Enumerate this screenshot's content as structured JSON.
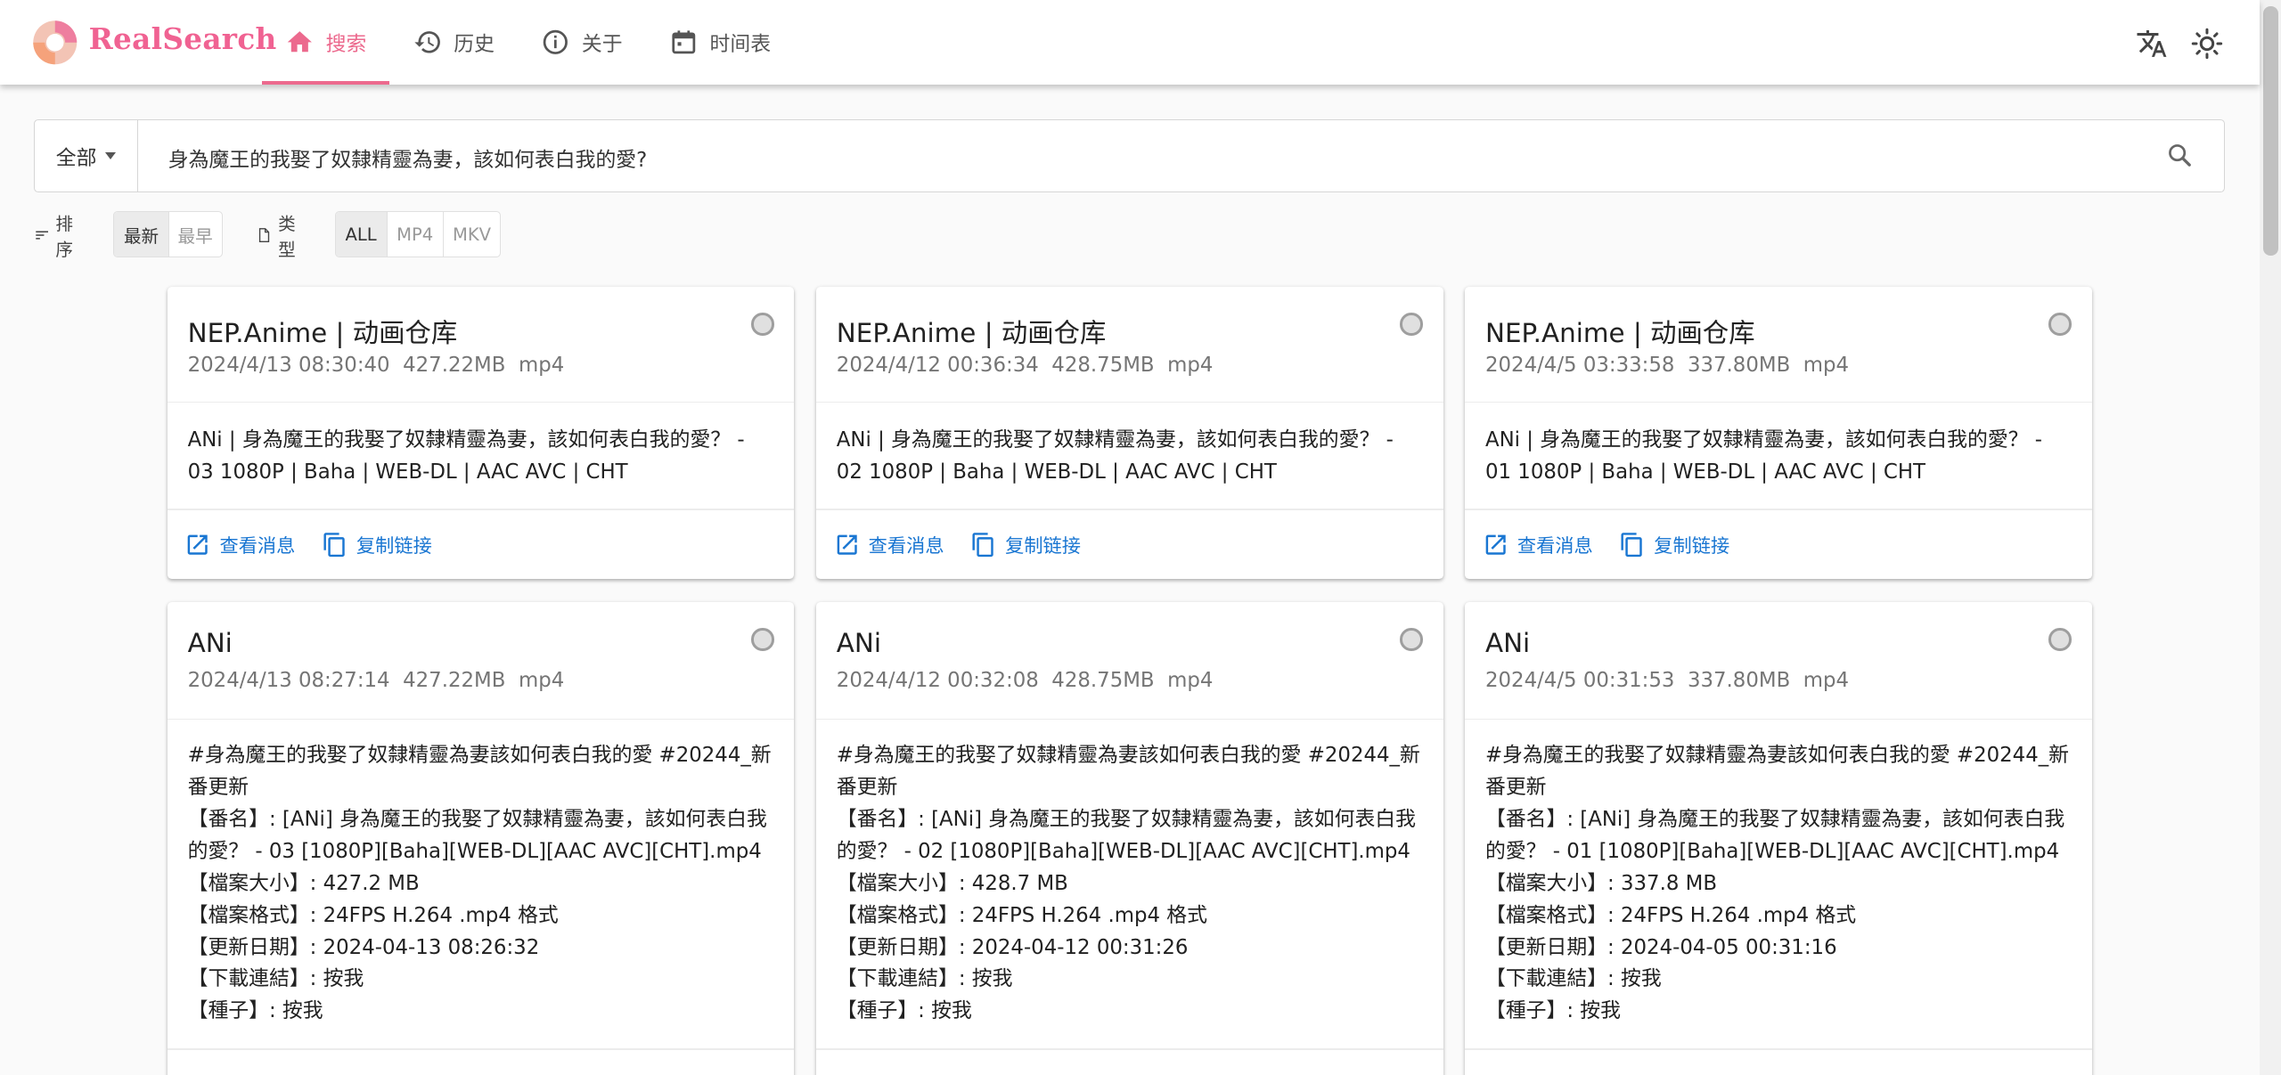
{
  "brand": {
    "name": "RealSearch",
    "accent": "#ec6a8e"
  },
  "nav": [
    {
      "label": "搜索",
      "icon": "home-icon",
      "active": true
    },
    {
      "label": "历史",
      "icon": "history-icon",
      "active": false
    },
    {
      "label": "关于",
      "icon": "info-icon",
      "active": false
    },
    {
      "label": "时间表",
      "icon": "calendar-icon",
      "active": false
    }
  ],
  "header_icons": [
    "translate-icon",
    "theme-toggle-icon"
  ],
  "search": {
    "scope": "全部",
    "query": "身為魔王的我娶了奴隸精靈為妻，該如何表白我的愛?"
  },
  "filters": {
    "sort_label": "排序",
    "sort_options": [
      "最新",
      "最早"
    ],
    "sort_selected": "最新",
    "type_label": "类型",
    "type_options": [
      "ALL",
      "MP4",
      "MKV"
    ],
    "type_selected": "ALL"
  },
  "actions": {
    "view": "查看消息",
    "copy": "复制链接"
  },
  "cards": [
    {
      "source": "NEP.Anime | 动画仓库",
      "meta": "2024/4/13 08:30:40  427.22MB  mp4",
      "body": "ANi | 身為魔王的我娶了奴隸精靈為妻，該如何表白我的愛？ - 03  1080P | Baha | WEB-DL | AAC AVC | CHT"
    },
    {
      "source": "NEP.Anime | 动画仓库",
      "meta": "2024/4/12 00:36:34  428.75MB  mp4",
      "body": "ANi | 身為魔王的我娶了奴隸精靈為妻，該如何表白我的愛？ - 02  1080P | Baha | WEB-DL | AAC AVC | CHT"
    },
    {
      "source": "NEP.Anime | 动画仓库",
      "meta": "2024/4/5 03:33:58  337.80MB  mp4",
      "body": "ANi | 身為魔王的我娶了奴隸精靈為妻，該如何表白我的愛？ - 01  1080P | Baha | WEB-DL | AAC AVC | CHT"
    },
    {
      "source": "ANi",
      "meta": "2024/4/13 08:27:14  427.22MB  mp4",
      "body": "#身為魔王的我娶了奴隸精靈為妻該如何表白我的愛 #20244_新番更新\n【番名】: [ANi] 身為魔王的我娶了奴隸精靈為妻，該如何表白我的愛？ - 03 [1080P][Baha][WEB-DL][AAC AVC][CHT].mp4\n【檔案大小】: 427.2  MB\n【檔案格式】: 24FPS H.264 .mp4 格式\n【更新日期】: 2024-04-13 08:26:32\n【下載連結】: 按我\n【種子】: 按我"
    },
    {
      "source": "ANi",
      "meta": "2024/4/12 00:32:08  428.75MB  mp4",
      "body": "#身為魔王的我娶了奴隸精靈為妻該如何表白我的愛 #20244_新番更新\n【番名】: [ANi] 身為魔王的我娶了奴隸精靈為妻，該如何表白我的愛？ - 02 [1080P][Baha][WEB-DL][AAC AVC][CHT].mp4\n【檔案大小】: 428.7  MB\n【檔案格式】: 24FPS H.264 .mp4 格式\n【更新日期】: 2024-04-12 00:31:26\n【下載連結】: 按我\n【種子】: 按我"
    },
    {
      "source": "ANi",
      "meta": "2024/4/5 00:31:53  337.80MB  mp4",
      "body": "#身為魔王的我娶了奴隸精靈為妻該如何表白我的愛 #20244_新番更新\n【番名】: [ANi] 身為魔王的我娶了奴隸精靈為妻，該如何表白我的愛？ - 01 [1080P][Baha][WEB-DL][AAC AVC][CHT].mp4\n【檔案大小】: 337.8  MB\n【檔案格式】: 24FPS H.264 .mp4 格式\n【更新日期】: 2024-04-05 00:31:16\n【下載連結】: 按我\n【種子】: 按我"
    }
  ]
}
